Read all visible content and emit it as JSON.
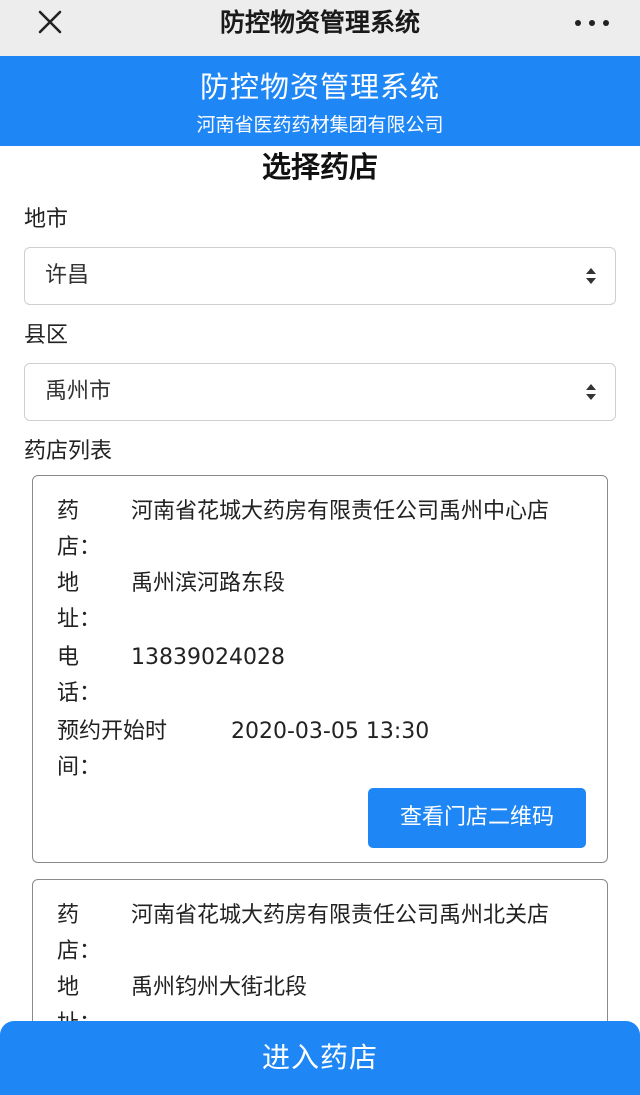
{
  "topbar": {
    "title": "防控物资管理系统",
    "close_icon": "close-icon",
    "more_icon": "more-icon"
  },
  "banner": {
    "title": "防控物资管理系统",
    "subtitle": "河南省医药药材集团有限公司"
  },
  "page": {
    "heading": "选择药店"
  },
  "city": {
    "label": "地市",
    "value": "许昌"
  },
  "district": {
    "label": "县区",
    "value": "禹州市"
  },
  "list": {
    "label": "药店列表",
    "stores": [
      {
        "name_label": "药店：",
        "name": "河南省花城大药房有限责任公司禹州中心店",
        "address_label": "地址：",
        "address": "禹州滨河路东段",
        "phone_label": "电话：",
        "phone": "13839024028",
        "time_label": "预约开始时间：",
        "time": "2020-03-05 13:30",
        "qr_button": "查看门店二维码"
      },
      {
        "name_label": "药店：",
        "name": "河南省花城大药房有限责任公司禹州北关店",
        "address_label": "地址：",
        "address": "禹州钧州大街北段"
      }
    ]
  },
  "footer": {
    "enter_button": "进入药店"
  },
  "colors": {
    "accent": "#1f87f5",
    "topbar": "#ededed"
  }
}
